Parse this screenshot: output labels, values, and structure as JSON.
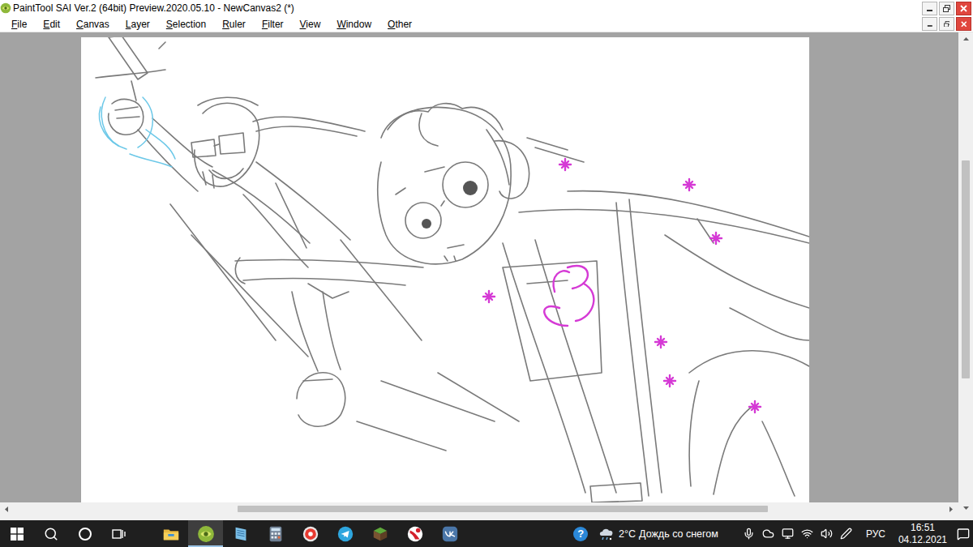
{
  "window": {
    "title": "PaintTool SAI Ver.2 (64bit) Preview.2020.05.10 - NewCanvas2 (*)"
  },
  "menu": [
    "File",
    "Edit",
    "Canvas",
    "Layer",
    "Selection",
    "Ruler",
    "Filter",
    "View",
    "Window",
    "Other"
  ],
  "scrollbars": {
    "horizontal": {
      "offset": 0.24,
      "level": 0.57
    },
    "vertical": {
      "offset": 0.25,
      "level": 0.48
    }
  },
  "taskbar": {
    "apps": [
      {
        "kind": "explorer",
        "selected": false
      },
      {
        "kind": "sai",
        "selected": true
      },
      {
        "kind": "notepad",
        "selected": false
      },
      {
        "kind": "calculator",
        "selected": false
      },
      {
        "kind": "yandex",
        "selected": false
      },
      {
        "kind": "telegram",
        "selected": false
      },
      {
        "kind": "minecraft",
        "selected": false
      },
      {
        "kind": "redapp",
        "selected": false
      },
      {
        "kind": "vk",
        "selected": false
      }
    ],
    "help": "?",
    "weather": {
      "temperature": "2°C",
      "description": "Дождь со снегом"
    },
    "language": "РУС",
    "time": "16:51",
    "date": "04.12.2021"
  }
}
